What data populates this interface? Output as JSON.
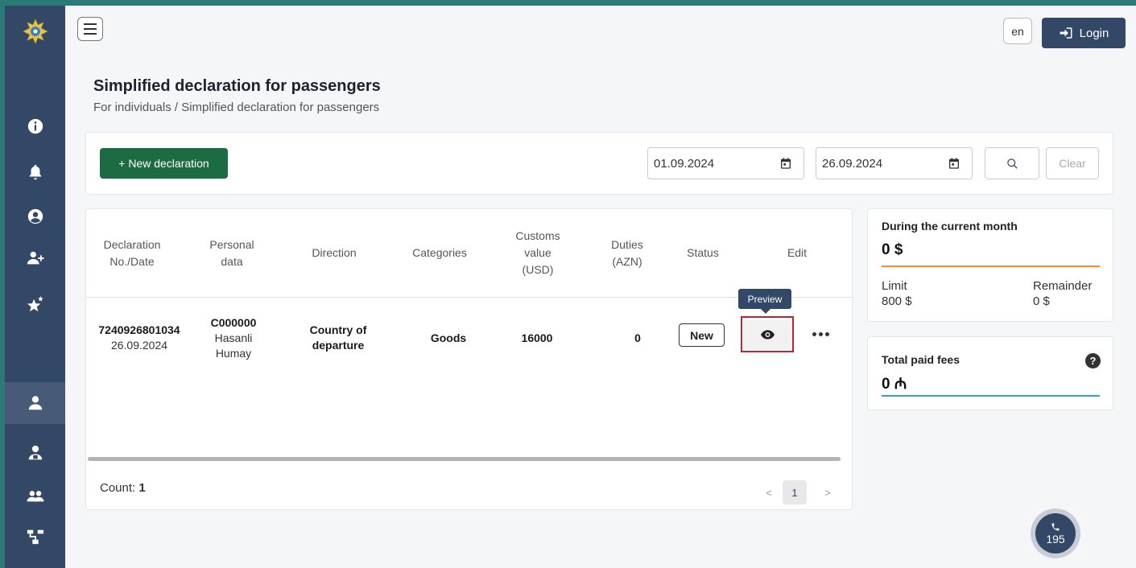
{
  "header": {
    "lang": "en",
    "login_label": "Login"
  },
  "page": {
    "title": "Simplified declaration for passengers",
    "breadcrumb": "For individuals / Simplified declaration for passengers"
  },
  "toolbar": {
    "new_declaration_label": "+ New declaration",
    "date_from": "01.09.2024",
    "date_to": "26.09.2024",
    "clear_label": "Clear"
  },
  "table": {
    "headers": {
      "decl_no": "Declaration No./Date",
      "personal": "Personal data",
      "direction": "Direction",
      "categories": "Categories",
      "customs": "Customs value (USD)",
      "duties": "Duties (AZN)",
      "status": "Status",
      "edit": "Edit"
    },
    "rows": [
      {
        "decl_no": "7240926801034",
        "date": "26.09.2024",
        "personal_id": "C000000",
        "surname": "Hasanli",
        "name": "Humay",
        "direction": "Country of departure",
        "category": "Goods",
        "customs_value": "16000",
        "duties": "0",
        "status": "New"
      }
    ],
    "tooltip": "Preview",
    "count_label": "Count:",
    "count_value": "1",
    "pager_prev": "<",
    "pager_page": "1",
    "pager_next": ">"
  },
  "stats": {
    "current_month_label": "During the current month",
    "current_month_value": "0 $",
    "limit_label": "Limit",
    "limit_value": "800 $",
    "remainder_label": "Remainder",
    "remainder_value": "0 $",
    "fees_label": "Total paid fees",
    "fees_value": "0 ₼"
  },
  "support": {
    "phone": "195"
  },
  "colors": {
    "sidebar": "#334766",
    "primary_green": "#1d6b43",
    "orange_line": "#e8903a",
    "blue_line": "#3a9ad9",
    "highlight_red": "#c8202a"
  }
}
